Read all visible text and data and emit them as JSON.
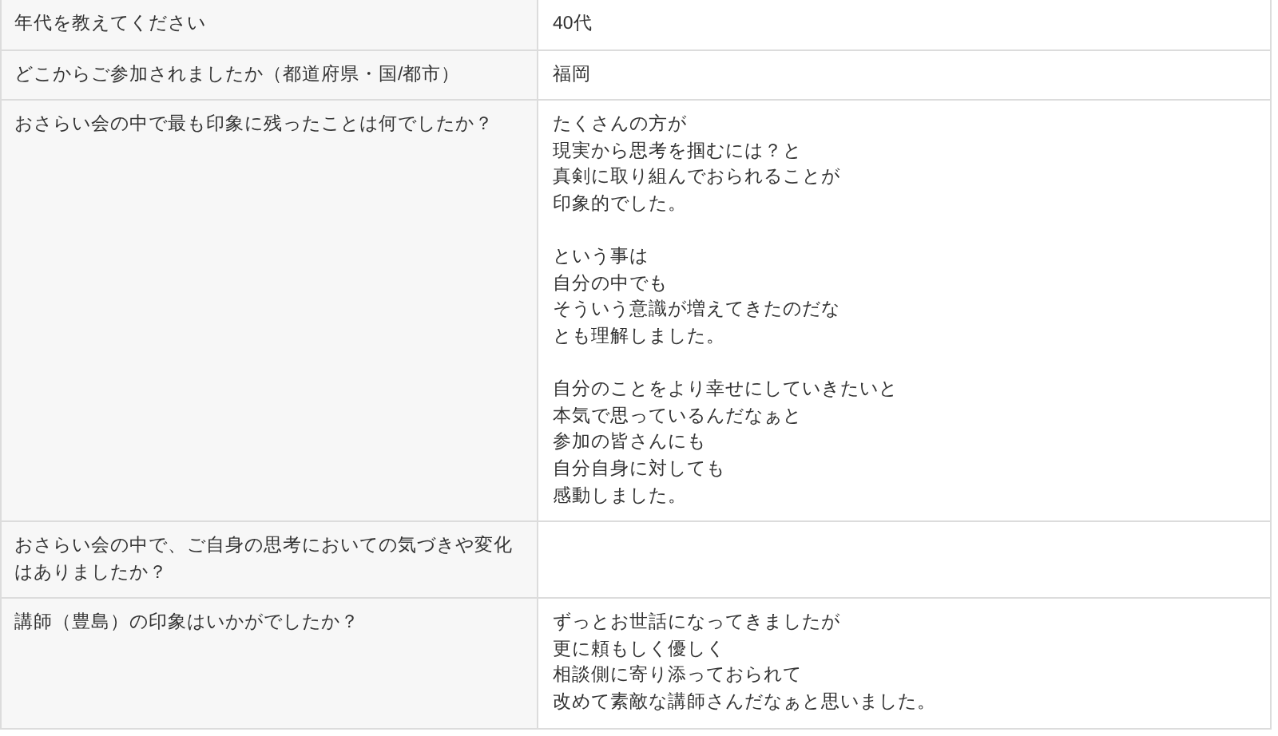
{
  "rows": [
    {
      "question": "年代を教えてください",
      "answer": [
        [
          "40代"
        ]
      ]
    },
    {
      "question": "どこからご参加されましたか（都道府県・国/都市）",
      "answer": [
        [
          "福岡"
        ]
      ]
    },
    {
      "question": "おさらい会の中で最も印象に残ったことは何でしたか？",
      "answer": [
        [
          "たくさんの方が",
          "現実から思考を掴むには？と",
          "真剣に取り組んでおられることが",
          "印象的でした。"
        ],
        [
          "という事は",
          "自分の中でも",
          "そういう意識が増えてきたのだな",
          "とも理解しました。"
        ],
        [
          "自分のことをより幸せにしていきたいと",
          "本気で思っているんだなぁと",
          "参加の皆さんにも",
          "自分自身に対しても",
          "感動しました。"
        ]
      ]
    },
    {
      "question": "おさらい会の中で、ご自身の思考においての気づきや変化はありましたか？"
    },
    {
      "question": "講師（豊島）の印象はいかがでしたか？",
      "answer": [
        [
          "ずっとお世話になってきましたが",
          "更に頼もしく優しく",
          "相談側に寄り添っておられて",
          "改めて素敵な講師さんだなぁと思いました。"
        ]
      ]
    }
  ]
}
